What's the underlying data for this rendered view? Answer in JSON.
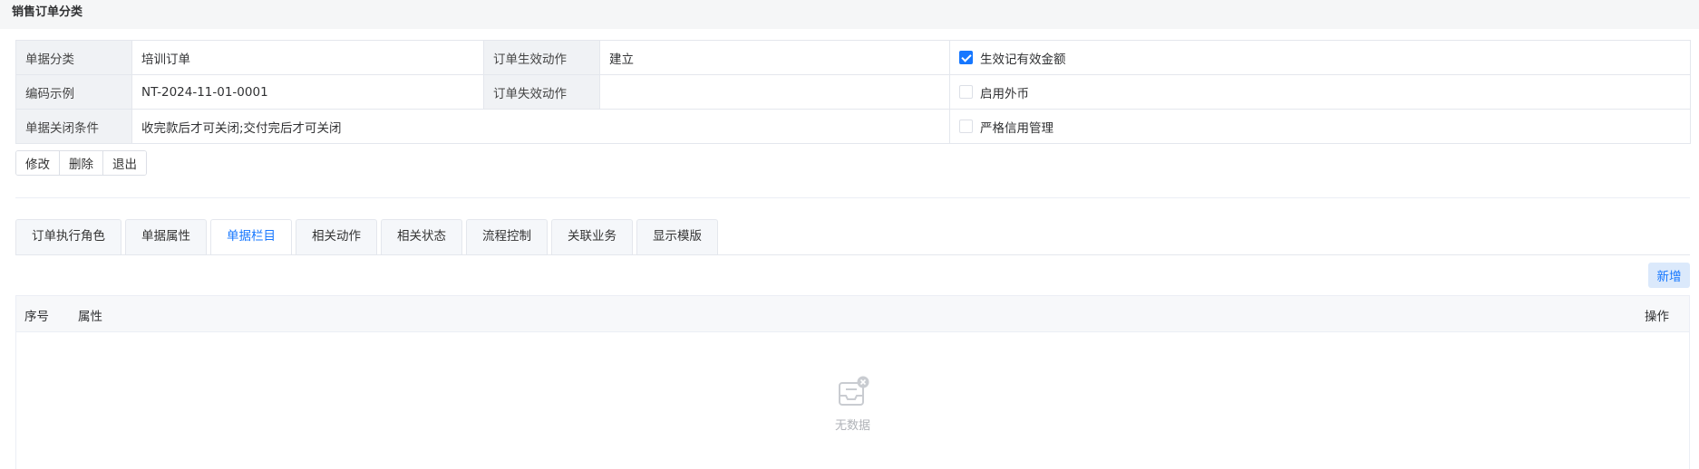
{
  "page": {
    "title": "销售订单分类"
  },
  "info": {
    "row1": {
      "label1": "单据分类",
      "value1": "培训订单",
      "label2": "订单生效动作",
      "value2": "建立",
      "check_label": "生效记有效金额",
      "checked": true
    },
    "row2": {
      "label1": "编码示例",
      "value1": "NT-2024-11-01-0001",
      "label2": "订单失效动作",
      "value2": "",
      "check_label": "启用外币",
      "checked": false
    },
    "row3": {
      "label1": "单据关闭条件",
      "value1": "收完款后才可关闭;交付完后才可关闭",
      "check_label": "严格信用管理",
      "checked": false
    }
  },
  "actions": {
    "edit": "修改",
    "delete": "删除",
    "exit": "退出"
  },
  "tabs": [
    {
      "label": "订单执行角色",
      "active": false
    },
    {
      "label": "单据属性",
      "active": false
    },
    {
      "label": "单据栏目",
      "active": true
    },
    {
      "label": "相关动作",
      "active": false
    },
    {
      "label": "相关状态",
      "active": false
    },
    {
      "label": "流程控制",
      "active": false
    },
    {
      "label": "关联业务",
      "active": false
    },
    {
      "label": "显示模版",
      "active": false
    }
  ],
  "toolbar": {
    "add_label": "新增"
  },
  "grid": {
    "columns": {
      "seq": "序号",
      "attr": "属性",
      "ops": "操作"
    },
    "empty_text": "无数据",
    "empty_icon": "empty-inbox-icon"
  },
  "colors": {
    "accent": "#1677ff",
    "label_bg": "#f0f2f5",
    "add_bg": "#dbe9fb"
  }
}
